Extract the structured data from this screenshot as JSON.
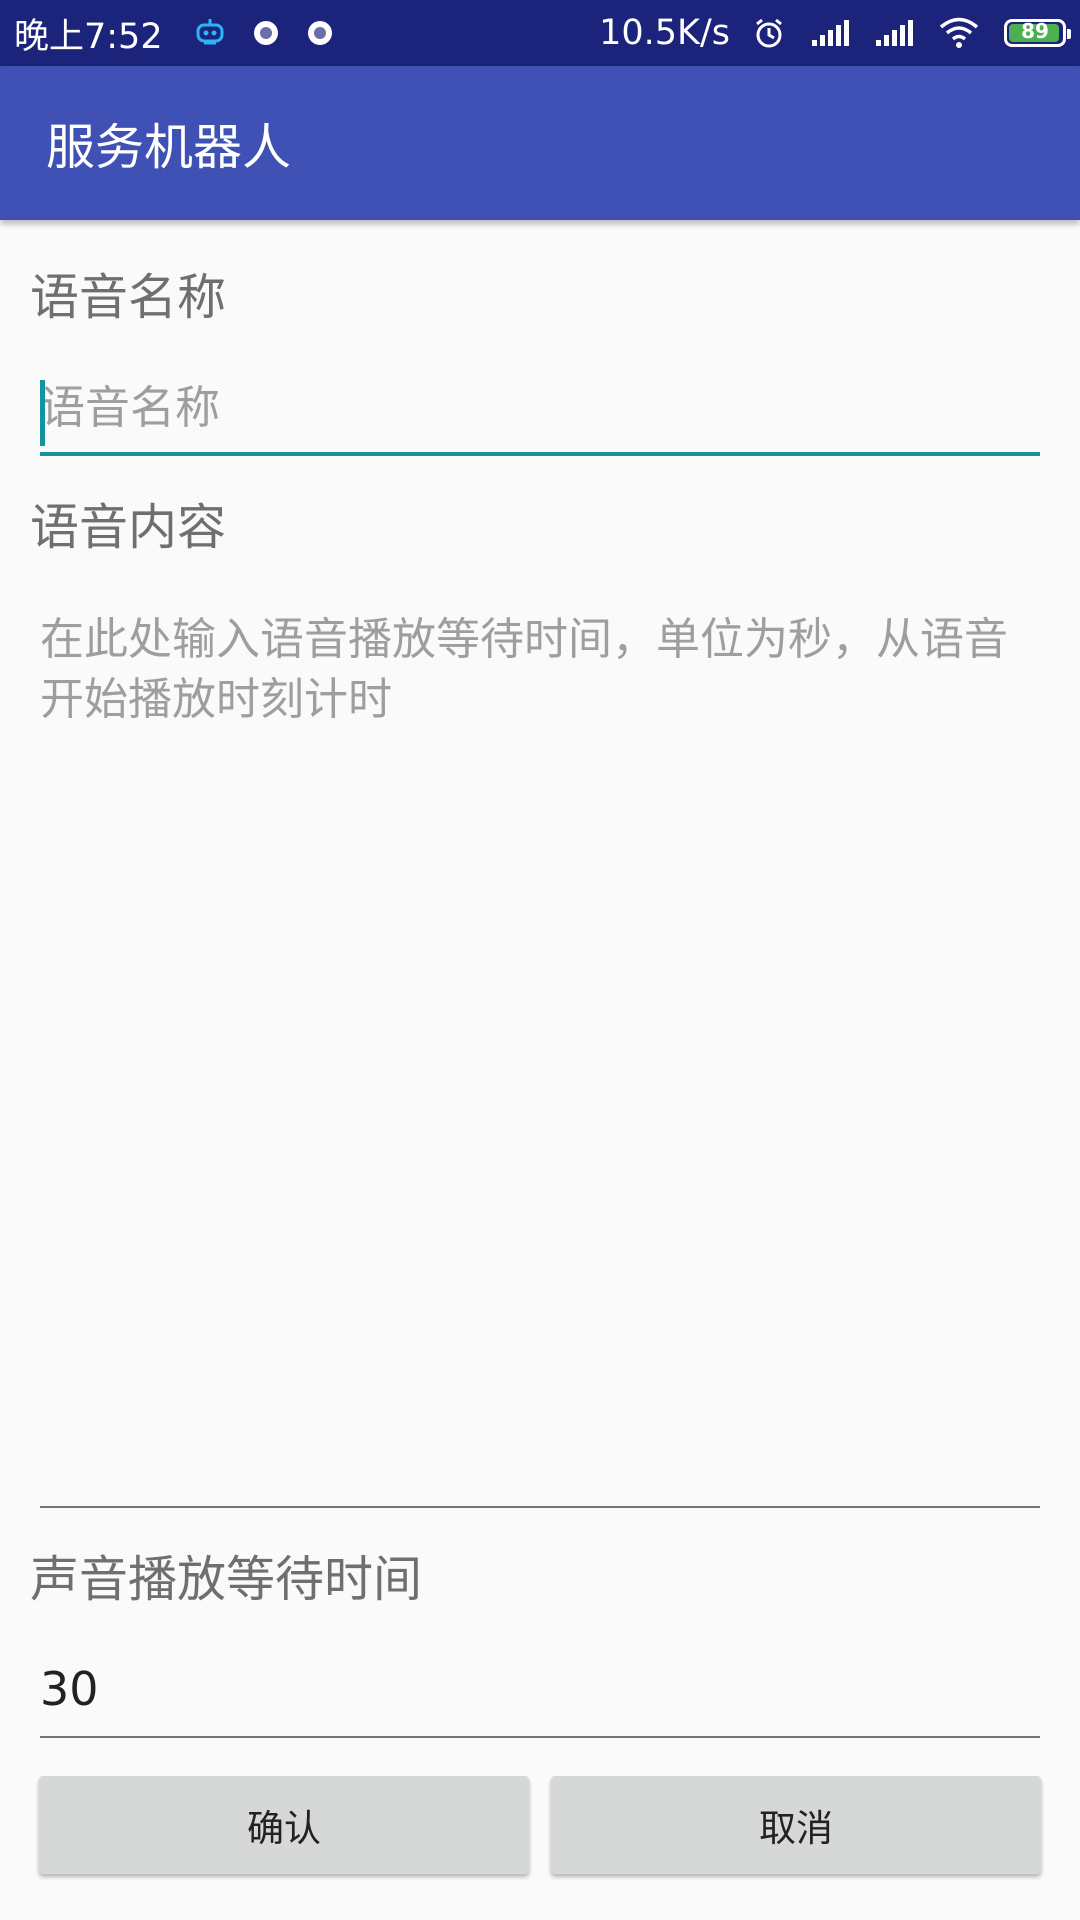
{
  "status_bar": {
    "time": "晚上7:52",
    "network_speed": "10.5K/s",
    "battery_level": "89",
    "battery_fraction": 0.89,
    "icons": [
      "robot-icon",
      "record-icon",
      "record-icon",
      "alarm-icon",
      "signal-icon",
      "signal-icon",
      "wifi-icon",
      "battery-icon"
    ]
  },
  "app_bar": {
    "title": "服务机器人",
    "color": "#3f51b5"
  },
  "form": {
    "name_label": "语音名称",
    "name_placeholder": "语音名称",
    "name_value": "",
    "content_label": "语音内容",
    "content_placeholder": "在此处输入语音播放等待时间，单位为秒，从语音开始播放时刻计时",
    "content_value": "",
    "wait_label": "声音播放等待时间",
    "wait_value": "30",
    "accent_color": "#12939e"
  },
  "buttons": {
    "confirm_label": "确认",
    "cancel_label": "取消"
  }
}
